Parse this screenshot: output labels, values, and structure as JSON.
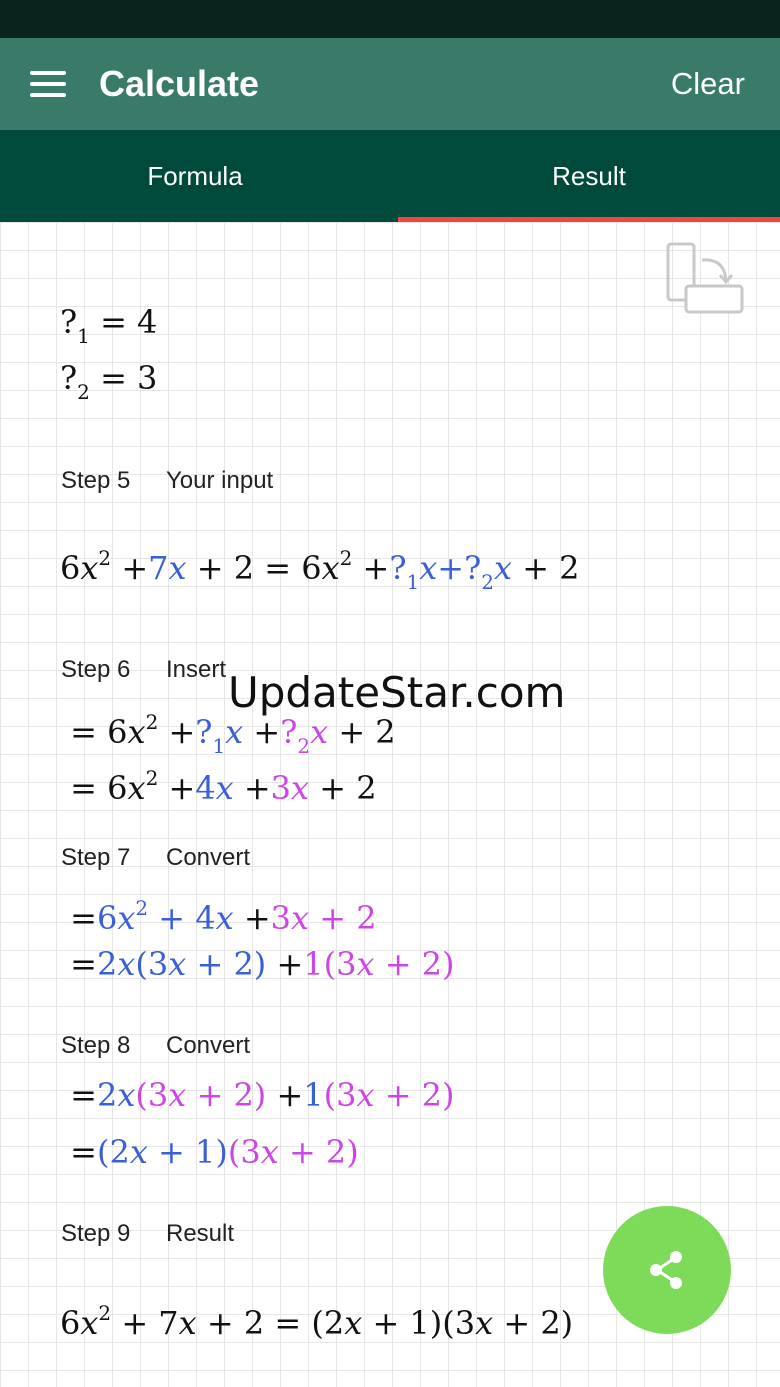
{
  "header": {
    "title": "Calculate",
    "clear_label": "Clear"
  },
  "tabs": [
    {
      "label": "Formula"
    },
    {
      "label": "Result"
    }
  ],
  "selected_tab": "Result",
  "icons": {
    "menu": "hamburger-menu-icon",
    "rotate": "rotate-screen-icon",
    "share": "share-icon"
  },
  "colors": {
    "appbar": "#3a7a68",
    "tabbar": "#004a3b",
    "indicator": "#f0463e",
    "blue": "#3a5fd9",
    "pink": "#cc46e6",
    "fab": "#7edb5a"
  },
  "watermark": "UpdateStar.com",
  "solution": {
    "values": [
      "?₁ = 4",
      "?₂ = 3"
    ],
    "steps": [
      {
        "number": "Step 5",
        "title": "Your input",
        "lines": [
          "6x² + 7x + 2 = 6x² + ?₁x + ?₂x + 2"
        ]
      },
      {
        "number": "Step 6",
        "title": "Insert",
        "lines": [
          "= 6x² + ?₁x + ?₂x + 2",
          "= 6x² + 4x + 3x + 2"
        ]
      },
      {
        "number": "Step 7",
        "title": "Convert",
        "lines": [
          "= 6x² + 4x + 3x + 2",
          "= 2x(3x + 2) + 1(3x + 2)"
        ]
      },
      {
        "number": "Step 8",
        "title": "Convert",
        "lines": [
          "= 2x(3x + 2) + 1(3x + 2)",
          "= (2x + 1)(3x + 2)"
        ]
      },
      {
        "number": "Step 9",
        "title": "Result",
        "lines": [
          "6x² + 7x + 2 = (2x + 1)(3x + 2)"
        ]
      }
    ]
  }
}
